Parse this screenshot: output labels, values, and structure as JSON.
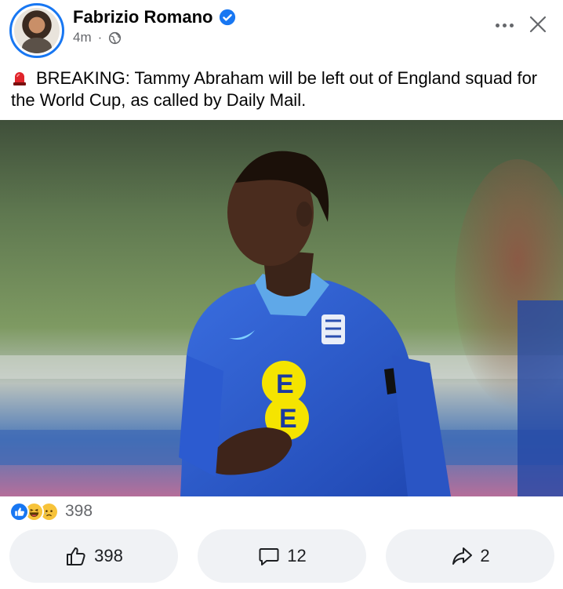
{
  "post": {
    "author": "Fabrizio Romano",
    "time": "4m",
    "separator": "·",
    "text": "BREAKING: Tammy Abraham will be left out of England squad for the World Cup, as called by Daily Mail.",
    "image": {
      "shirt_badge_text": "EE",
      "colors": {
        "jersey": "#2a56c9",
        "sponsor_circle": "#f5e400",
        "background_grass": "#6b8a4e"
      }
    }
  },
  "reactions": {
    "icons": [
      "like-icon",
      "haha-icon",
      "sad-icon"
    ],
    "count": "398"
  },
  "actions": {
    "like_count": "398",
    "comment_count": "12",
    "share_count": "2"
  },
  "colors": {
    "accent": "#1877f2",
    "secondary_text": "#65676b",
    "button_bg": "#f0f2f5"
  }
}
